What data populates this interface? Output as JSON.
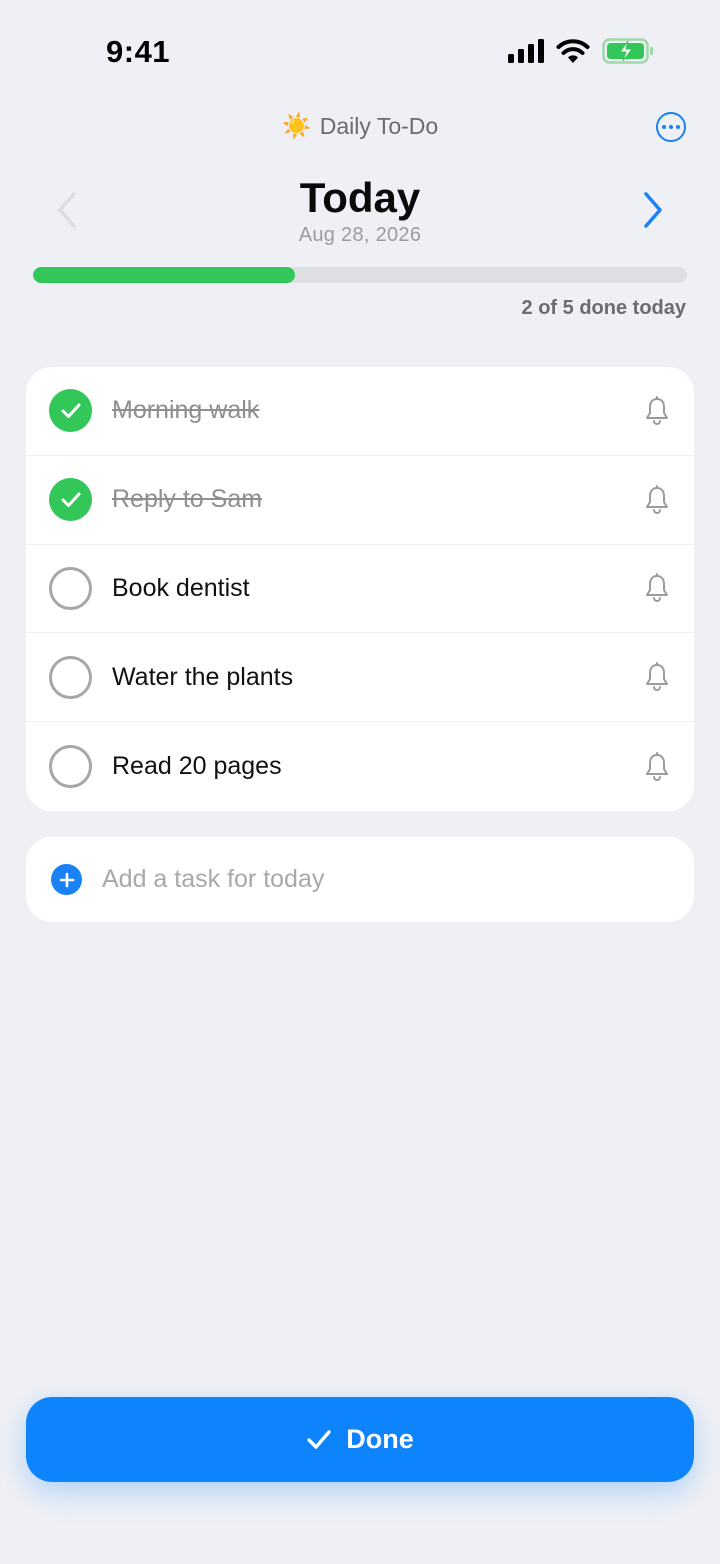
{
  "status_bar": {
    "time": "9:41"
  },
  "header": {
    "app_icon": "sun-emoji",
    "app_icon_glyph": "☀️",
    "app_title": "Daily To-Do",
    "more_icon": "ellipsis-circle-icon",
    "day_title": "Today",
    "date": "Aug 28, 2026"
  },
  "progress": {
    "done": 2,
    "total": 5,
    "fraction": 0.4,
    "label": "2 of 5 done today",
    "color": "#33c659"
  },
  "tasks": [
    {
      "label": "Morning walk",
      "done": true
    },
    {
      "label": "Reply to Sam",
      "done": true
    },
    {
      "label": "Book dentist",
      "done": false
    },
    {
      "label": "Water the plants",
      "done": false
    },
    {
      "label": "Read 20 pages",
      "done": false
    }
  ],
  "add_task": {
    "placeholder": "Add a task for today",
    "value": ""
  },
  "done_button": {
    "label": "Done",
    "icon": "checkmark-icon"
  },
  "colors": {
    "accent": "#0d84fb",
    "success": "#33c659",
    "background": "#eff0f5"
  }
}
